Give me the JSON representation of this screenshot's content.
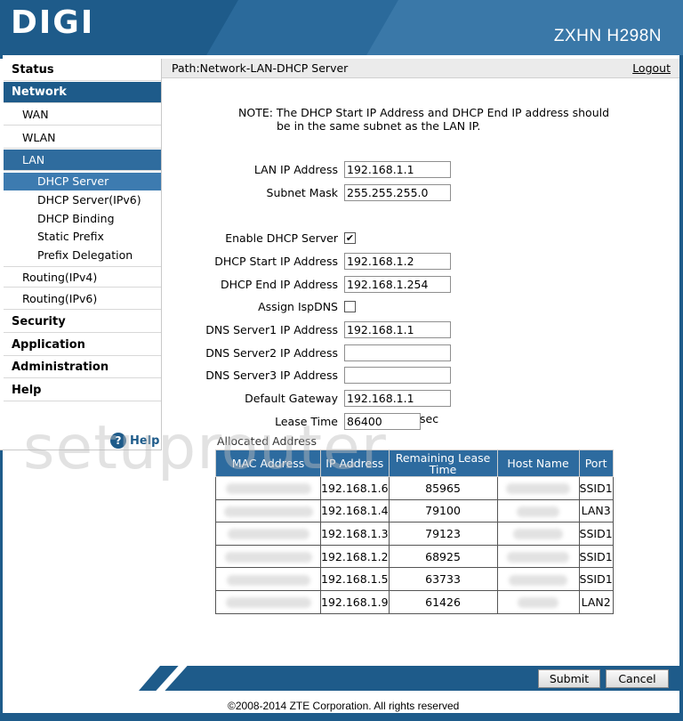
{
  "header": {
    "logo": "DIGI",
    "model": "ZXHN H298N"
  },
  "nav": {
    "status": "Status",
    "network": "Network",
    "wan": "WAN",
    "wlan": "WLAN",
    "lan": "LAN",
    "dhcp_server": "DHCP Server",
    "dhcp_server_ipv6": "DHCP Server(IPv6)",
    "dhcp_binding": "DHCP Binding",
    "static_prefix": "Static Prefix",
    "prefix_delegation": "Prefix Delegation",
    "routing_ipv4": "Routing(IPv4)",
    "routing_ipv6": "Routing(IPv6)",
    "security": "Security",
    "application": "Application",
    "administration": "Administration",
    "help": "Help",
    "help_link": "Help"
  },
  "pathbar": {
    "path": "Path:Network-LAN-DHCP Server",
    "logout": "Logout"
  },
  "note": {
    "line1": "NOTE: The DHCP Start IP Address and DHCP End IP address should",
    "line2": "be in the same subnet as the LAN IP."
  },
  "form": {
    "lan_ip_label": "LAN IP Address",
    "lan_ip": "192.168.1.1",
    "subnet_label": "Subnet Mask",
    "subnet": "255.255.255.0",
    "enable_dhcp_label": "Enable DHCP Server",
    "enable_dhcp_checked": true,
    "start_ip_label": "DHCP Start IP Address",
    "start_ip": "192.168.1.2",
    "end_ip_label": "DHCP End IP Address",
    "end_ip": "192.168.1.254",
    "assign_isp_dns_label": "Assign IspDNS",
    "assign_isp_dns_checked": false,
    "dns1_label": "DNS Server1 IP Address",
    "dns1": "192.168.1.1",
    "dns2_label": "DNS Server2 IP Address",
    "dns2": "",
    "dns3_label": "DNS Server3 IP Address",
    "dns3": "",
    "gateway_label": "Default Gateway",
    "gateway": "192.168.1.1",
    "lease_label": "Lease Time",
    "lease": "86400",
    "lease_unit": "sec"
  },
  "allocated": {
    "title": "Allocated Address",
    "columns": [
      "MAC Address",
      "IP Address",
      "Remaining Lease Time",
      "Host Name",
      "Port"
    ],
    "rows": [
      {
        "ip": "192.168.1.6",
        "lease": "85965",
        "port": "SSID1"
      },
      {
        "ip": "192.168.1.4",
        "lease": "79100",
        "port": "LAN3"
      },
      {
        "ip": "192.168.1.3",
        "lease": "79123",
        "port": "SSID1"
      },
      {
        "ip": "192.168.1.2",
        "lease": "68925",
        "port": "SSID1"
      },
      {
        "ip": "192.168.1.5",
        "lease": "63733",
        "port": "SSID1"
      },
      {
        "ip": "192.168.1.9",
        "lease": "61426",
        "port": "LAN2"
      }
    ]
  },
  "watermark": "setuprouter",
  "buttons": {
    "submit": "Submit",
    "cancel": "Cancel"
  },
  "footer": {
    "copyright": "©2008-2014 ZTE Corporation. All rights reserved"
  },
  "colors": {
    "brand_blue": "#1e5b8a",
    "header_table": "#2d6b9f"
  }
}
